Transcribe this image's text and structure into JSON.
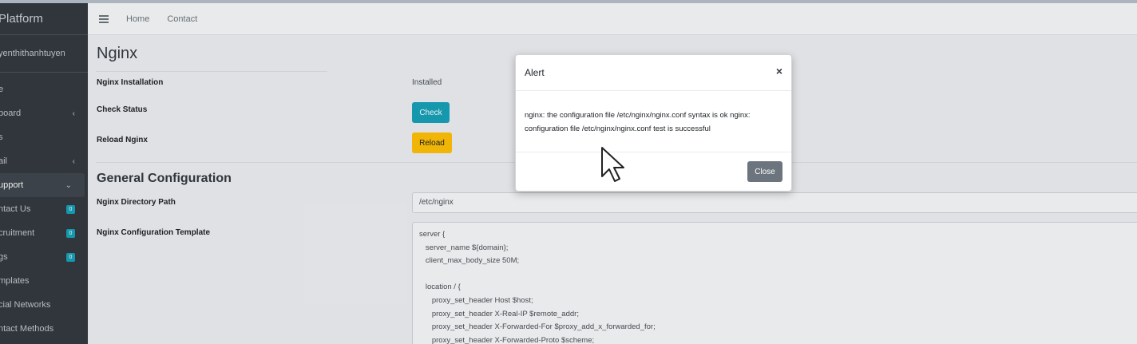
{
  "sidebar": {
    "brand": "Platform",
    "user": "yenthithanhtuyen",
    "items": [
      {
        "label": "e",
        "caret": "",
        "badge": ""
      },
      {
        "label": "board",
        "caret": "‹",
        "badge": ""
      },
      {
        "label": "s",
        "caret": "",
        "badge": ""
      },
      {
        "label": "ail",
        "caret": "‹",
        "badge": ""
      },
      {
        "label": "upport",
        "caret": "⌄",
        "badge": ""
      },
      {
        "label": "ntact Us",
        "caret": "",
        "badge": "0"
      },
      {
        "label": "cruitment",
        "caret": "",
        "badge": "0"
      },
      {
        "label": "gs",
        "caret": "",
        "badge": "0"
      },
      {
        "label": "mplates",
        "caret": "",
        "badge": ""
      },
      {
        "label": "cial Networks",
        "caret": "",
        "badge": ""
      },
      {
        "label": "ntact Methods",
        "caret": "",
        "badge": ""
      }
    ]
  },
  "header": {
    "nav": [
      "Home",
      "Contact"
    ]
  },
  "main": {
    "title": "Nginx",
    "installation_label": "Nginx Installation",
    "installation_value": "Installed",
    "check_label": "Check Status",
    "check_button": "Check",
    "reload_label": "Reload Nginx",
    "reload_button": "Reload",
    "general_title": "General Configuration",
    "dir_label": "Nginx Directory Path",
    "dir_value": "/etc/nginx",
    "template_label": "Nginx Configuration Template",
    "template_lines": [
      "server {",
      "   server_name ${domain};",
      "   client_max_body_size 50M;",
      "",
      "   location / {",
      "      proxy_set_header Host $host;",
      "      proxy_set_header X-Real-IP $remote_addr;",
      "      proxy_set_header X-Forwarded-For $proxy_add_x_forwarded_for;",
      "      proxy_set_header X-Forwarded-Proto $scheme;"
    ]
  },
  "modal": {
    "title": "Alert",
    "close_symbol": "×",
    "message": "nginx: the configuration file /etc/nginx/nginx.conf syntax is ok nginx: configuration file /etc/nginx/nginx.conf test is successful",
    "close_button": "Close"
  },
  "colors": {
    "sidebar_bg": "#343a40",
    "info": "#17a2b8",
    "warning": "#ffc107",
    "secondary": "#6c757d"
  }
}
